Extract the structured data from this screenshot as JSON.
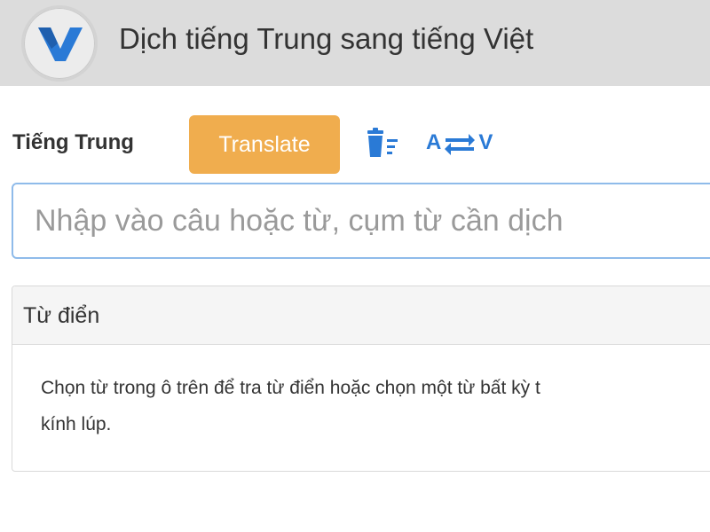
{
  "header": {
    "title": "Dịch tiếng Trung sang tiếng Việt",
    "logo_icon": "v-logo-icon",
    "logo_color": "#2a7ad6"
  },
  "toolbar": {
    "source_language": "Tiếng Trung",
    "translate_label": "Translate",
    "clear_icon": "trash-list-icon",
    "swap_from": "A",
    "swap_to": "V",
    "swap_icon": "swap-arrows-icon",
    "accent_color": "#f0ad4e",
    "icon_color": "#2a7ad6"
  },
  "input": {
    "placeholder": "Nhập vào câu hoặc từ, cụm từ cần dịch",
    "value": ""
  },
  "dictionary": {
    "heading": "Từ điển",
    "line1": "Chọn từ trong ô trên để tra từ điển hoặc chọn một từ bất kỳ t",
    "line2": "kính lúp."
  }
}
